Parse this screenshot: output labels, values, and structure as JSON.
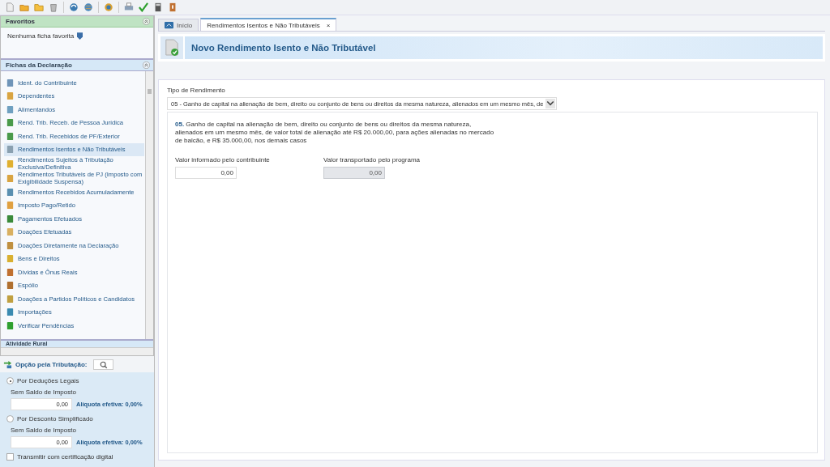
{
  "favorites": {
    "title": "Favoritos",
    "empty_text": "Nenhuma ficha favorita"
  },
  "sheets": {
    "title": "Fichas da Declaração",
    "items": [
      {
        "label": "Ident. do Contribuinte",
        "selected": false
      },
      {
        "label": "Dependentes",
        "selected": false
      },
      {
        "label": "Alimentandos",
        "selected": false
      },
      {
        "label": "Rend. Trib. Receb. de Pessoa Jurídica",
        "selected": false
      },
      {
        "label": "Rend. Trib. Recebidos de PF/Exterior",
        "selected": false
      },
      {
        "label": "Rendimentos Isentos e Não Tributáveis",
        "selected": true
      },
      {
        "label": "Rendimentos Sujeitos à Tributação Exclusiva/Definitiva",
        "selected": false
      },
      {
        "label": "Rendimentos Tributáveis de PJ (Imposto com Exigibilidade Suspensa)",
        "selected": false
      },
      {
        "label": "Rendimentos Recebidos Acumuladamente",
        "selected": false
      },
      {
        "label": "Imposto Pago/Retido",
        "selected": false
      },
      {
        "label": "Pagamentos Efetuados",
        "selected": false
      },
      {
        "label": "Doações Efetuadas",
        "selected": false
      },
      {
        "label": "Doações Diretamente na Declaração",
        "selected": false
      },
      {
        "label": "Bens e Direitos",
        "selected": false
      },
      {
        "label": "Dívidas e Ônus Reais",
        "selected": false
      },
      {
        "label": "Espólio",
        "selected": false
      },
      {
        "label": "Doações a Partidos Políticos e Candidatos",
        "selected": false
      },
      {
        "label": "Importações",
        "selected": false
      },
      {
        "label": "Verificar Pendências",
        "selected": false
      }
    ]
  },
  "next_section": {
    "title": "Atividade Rural"
  },
  "taxation": {
    "title": "Opção pela Tributação:",
    "options": [
      {
        "label": "Por Deduções Legais",
        "selected": true,
        "sublabel": "Sem Saldo de Imposto",
        "value": "0,00",
        "rate": "Alíquota efetiva: 0,00%"
      },
      {
        "label": "Por Desconto Simplificado",
        "selected": false,
        "sublabel": "Sem Saldo de Imposto",
        "value": "0,00",
        "rate": "Alíquota efetiva: 0,00%"
      }
    ],
    "certificate": {
      "label": "Transmitir com certificação digital",
      "checked": false
    }
  },
  "tabs": [
    {
      "label": "Início",
      "selected": false,
      "closable": false
    },
    {
      "label": "Rendimentos Isentos e Não Tributáveis",
      "selected": true,
      "closable": true,
      "close": "×"
    }
  ],
  "header": {
    "title": "Novo Rendimento Isento e Não Tributável"
  },
  "form": {
    "type_label": "Tipo de Rendimento",
    "type_value": "05 - Ganho de capital na alienação de bem, direito ou conjunto de bens ou direitos da mesma natureza, alienados em um mesmo mês, de",
    "description": "**05.** Ganho de capital na alienação de bem, direito ou conjunto de bens ou direitos da mesma natureza, alienados em um mesmo mês, de valor total de alienação até R$ 20.000,00, para ações alienadas no mercado de balcão, e R$ 35.000,00, nos demais casos",
    "fields": [
      {
        "label": "Valor informado pelo contribuinte",
        "value": "0,00",
        "disabled": false
      },
      {
        "label": "Valor transportado pelo programa",
        "value": "0,00",
        "disabled": true
      }
    ]
  }
}
